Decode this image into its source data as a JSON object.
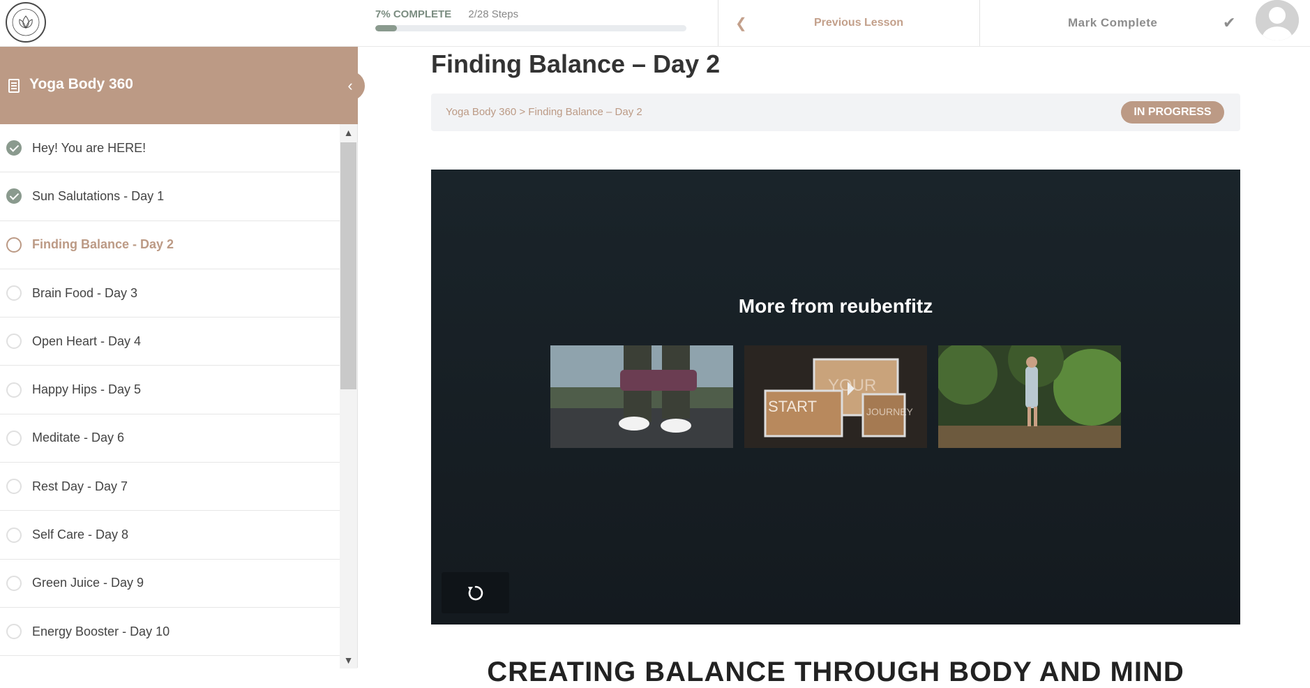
{
  "topbar": {
    "progress_pct_label": "7% COMPLETE",
    "progress_steps_label": "2/28 Steps",
    "progress_fraction": 0.07,
    "prev_lesson_label": "Previous Lesson",
    "mark_complete_label": "Mark Complete",
    "icons": [
      "logo-icon",
      "chevron-left-icon",
      "check-icon",
      "avatar-icon"
    ]
  },
  "sidebar": {
    "course_title": "Yoga Body 360",
    "lessons": [
      {
        "label": "Hey! You are HERE!",
        "status": "complete"
      },
      {
        "label": "Sun Salutations - Day 1",
        "status": "complete"
      },
      {
        "label": "Finding Balance - Day 2",
        "status": "current"
      },
      {
        "label": "Brain Food - Day 3",
        "status": "incomplete"
      },
      {
        "label": "Open Heart - Day 4",
        "status": "incomplete"
      },
      {
        "label": "Happy Hips - Day 5",
        "status": "incomplete"
      },
      {
        "label": "Meditate - Day 6",
        "status": "incomplete"
      },
      {
        "label": "Rest Day - Day 7",
        "status": "incomplete"
      },
      {
        "label": "Self Care - Day 8",
        "status": "incomplete"
      },
      {
        "label": "Green Juice - Day 9",
        "status": "incomplete"
      },
      {
        "label": "Energy Booster - Day 10",
        "status": "incomplete"
      }
    ]
  },
  "main": {
    "page_title": "Finding Balance – Day 2",
    "breadcrumb": "Yoga Body 360 > Finding Balance – Day 2",
    "status_badge": "IN PROGRESS",
    "video": {
      "more_title": "More from reubenfitz",
      "thumbnail_texts": [
        "START",
        "YOUR",
        "JOURNEY"
      ]
    },
    "section_heading": "CREATING BALANCE THROUGH BODY AND MIND"
  },
  "colors": {
    "accent": "#bc9a85",
    "progress": "#8a9a8e",
    "video_bg": "#1a242a"
  }
}
